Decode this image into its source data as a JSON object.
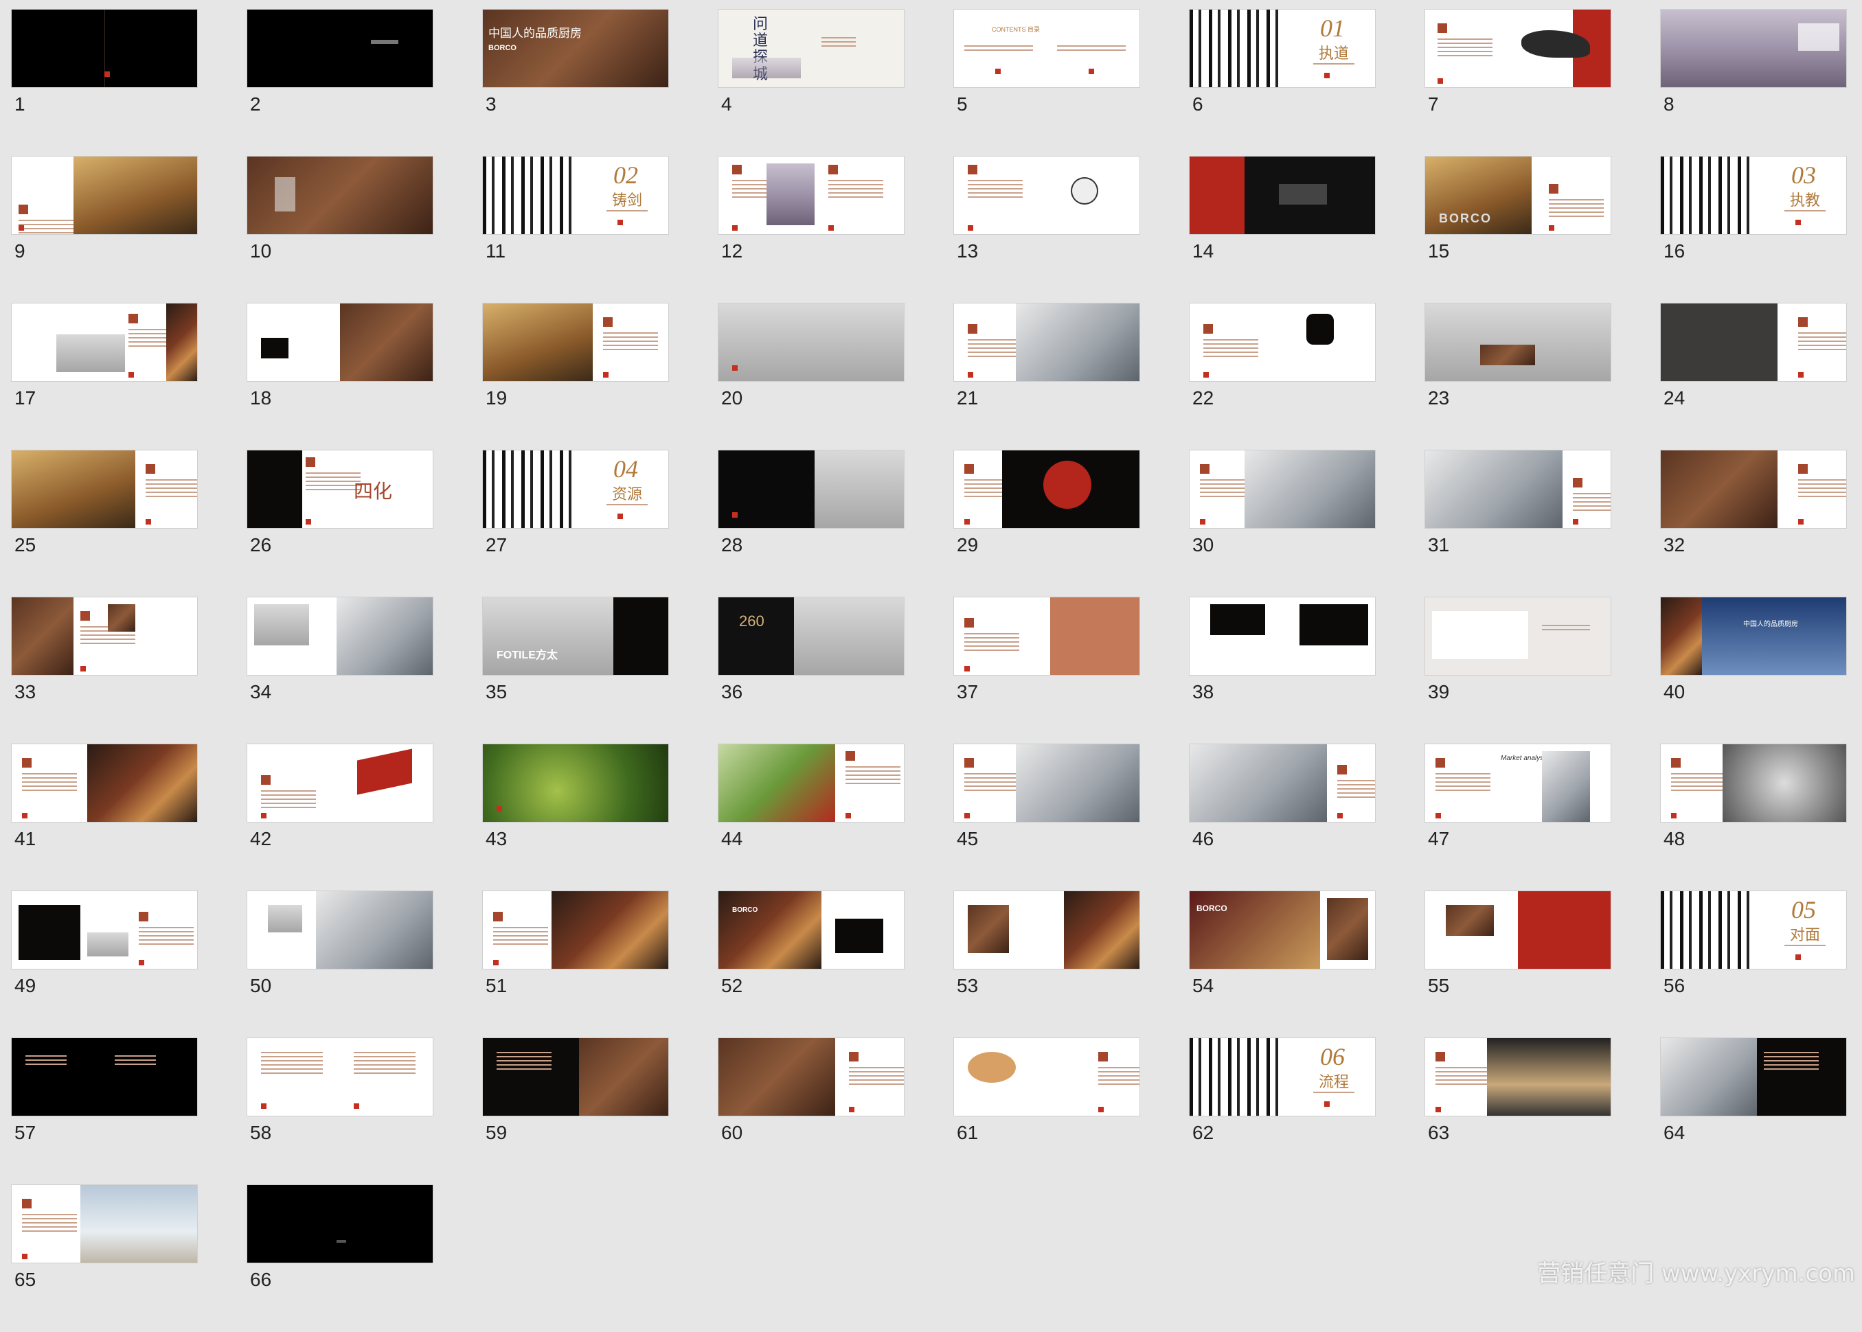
{
  "slides": [
    {
      "n": "1"
    },
    {
      "n": "2"
    },
    {
      "n": "3"
    },
    {
      "n": "4"
    },
    {
      "n": "5"
    },
    {
      "n": "6"
    },
    {
      "n": "7"
    },
    {
      "n": "8"
    },
    {
      "n": "9"
    },
    {
      "n": "10"
    },
    {
      "n": "11"
    },
    {
      "n": "12"
    },
    {
      "n": "13"
    },
    {
      "n": "14"
    },
    {
      "n": "15"
    },
    {
      "n": "16"
    },
    {
      "n": "17"
    },
    {
      "n": "18"
    },
    {
      "n": "19"
    },
    {
      "n": "20"
    },
    {
      "n": "21"
    },
    {
      "n": "22"
    },
    {
      "n": "23"
    },
    {
      "n": "24"
    },
    {
      "n": "25"
    },
    {
      "n": "26"
    },
    {
      "n": "27"
    },
    {
      "n": "28"
    },
    {
      "n": "29"
    },
    {
      "n": "30"
    },
    {
      "n": "31"
    },
    {
      "n": "32"
    },
    {
      "n": "33"
    },
    {
      "n": "34"
    },
    {
      "n": "35"
    },
    {
      "n": "36"
    },
    {
      "n": "37"
    },
    {
      "n": "38"
    },
    {
      "n": "39"
    },
    {
      "n": "40"
    },
    {
      "n": "41"
    },
    {
      "n": "42"
    },
    {
      "n": "43"
    },
    {
      "n": "44"
    },
    {
      "n": "45"
    },
    {
      "n": "46"
    },
    {
      "n": "47"
    },
    {
      "n": "48"
    },
    {
      "n": "49"
    },
    {
      "n": "50"
    },
    {
      "n": "51"
    },
    {
      "n": "52"
    },
    {
      "n": "53"
    },
    {
      "n": "54"
    },
    {
      "n": "55"
    },
    {
      "n": "56"
    },
    {
      "n": "57"
    },
    {
      "n": "58"
    },
    {
      "n": "59"
    },
    {
      "n": "60"
    },
    {
      "n": "61"
    },
    {
      "n": "62"
    },
    {
      "n": "63"
    },
    {
      "n": "64"
    },
    {
      "n": "65"
    },
    {
      "n": "66"
    }
  ],
  "thumb_text": {
    "s3_title": "中国人的品质厨房",
    "s3_brand": "BORCO",
    "s4_title": "问道 探城",
    "s5_title": "CONTENTS 目录",
    "s6_chapter": "01",
    "s6_title": "执道",
    "s11_chapter": "02",
    "s11_title": "铸剑",
    "s15_brand": "BORCO",
    "s16_chapter": "03",
    "s16_title": "执教",
    "s26_title": "四化",
    "s27_chapter": "04",
    "s27_title": "资源",
    "s35_brand": "FOTILE方太",
    "s36_number": "260",
    "s40_banner": "中国人的品质厨房",
    "s47_caption": "Market analysis",
    "s52_brand": "BORCO",
    "s54_brand": "BORCO",
    "s56_chapter": "05",
    "s56_title": "对面",
    "s62_chapter": "06",
    "s62_title": "流程"
  },
  "watermark": "营销任意门 www.yxrym.com",
  "colors": {
    "background": "#e6e6e6",
    "accent_red": "#c4301f",
    "gold": "#b07a3a"
  }
}
